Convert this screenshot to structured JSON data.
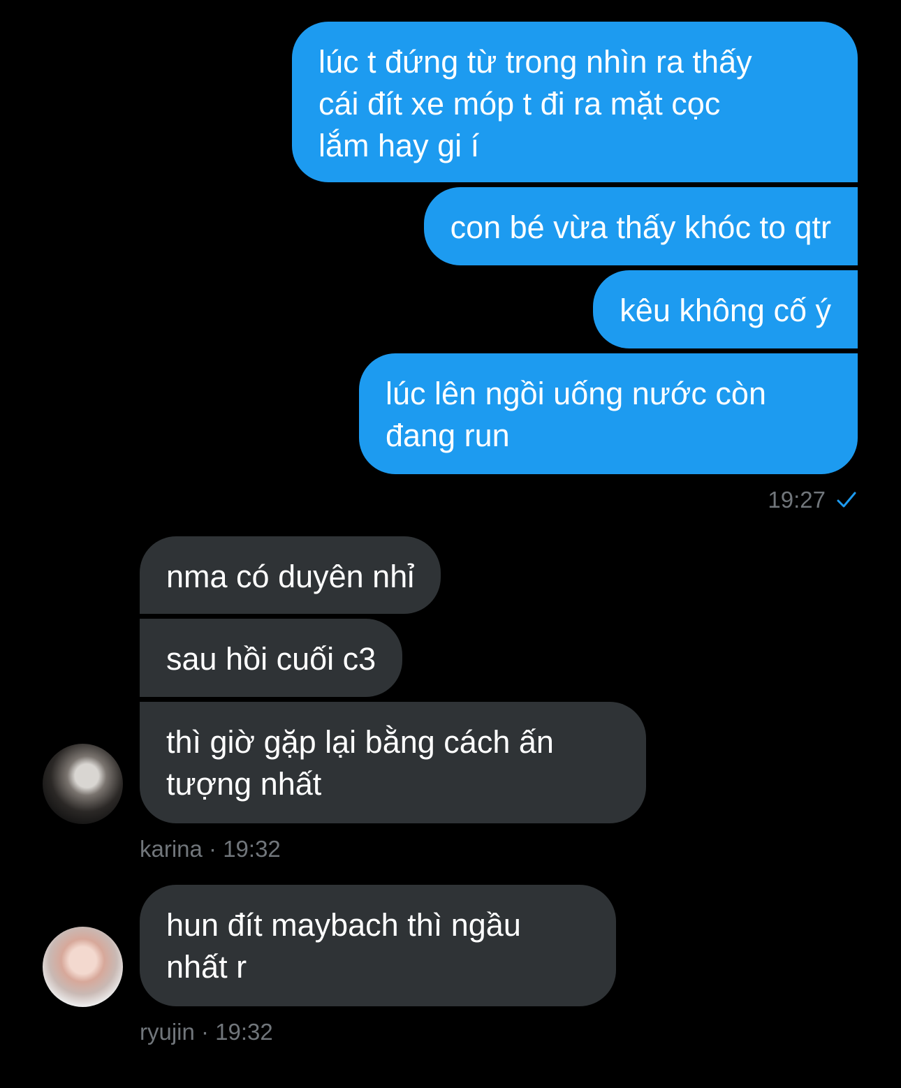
{
  "colors": {
    "background": "#000000",
    "sent_bubble": "#1d9bf0",
    "received_bubble": "#2f3336",
    "meta_text": "#71767b",
    "read_check": "#1d9bf0"
  },
  "sent_messages": [
    {
      "text": "lúc t đứng từ trong nhìn ra thấy\ncái đít xe móp t đi ra mặt cọc\nlắm hay gi í"
    },
    {
      "text": "con bé vừa thấy khóc to qtr"
    },
    {
      "text": "kêu không cố ý"
    },
    {
      "text": "lúc lên ngồi uống nước còn\nđang run"
    }
  ],
  "sent_meta": {
    "time": "19:27",
    "status_icon": "check-icon"
  },
  "received_groups": [
    {
      "sender": "karina",
      "avatar": "avatar-karina",
      "meta": "karina · 19:32",
      "messages": [
        {
          "text": "nma có duyên nhỉ"
        },
        {
          "text": "sau hồi cuối c3"
        },
        {
          "text": "thì giờ gặp lại bằng cách ấn\ntượng nhất"
        }
      ]
    },
    {
      "sender": "ryujin",
      "avatar": "avatar-ryujin",
      "meta": "ryujin · 19:32",
      "messages": [
        {
          "text": "hun đít maybach thì ngầu\nnhất r"
        }
      ]
    }
  ]
}
